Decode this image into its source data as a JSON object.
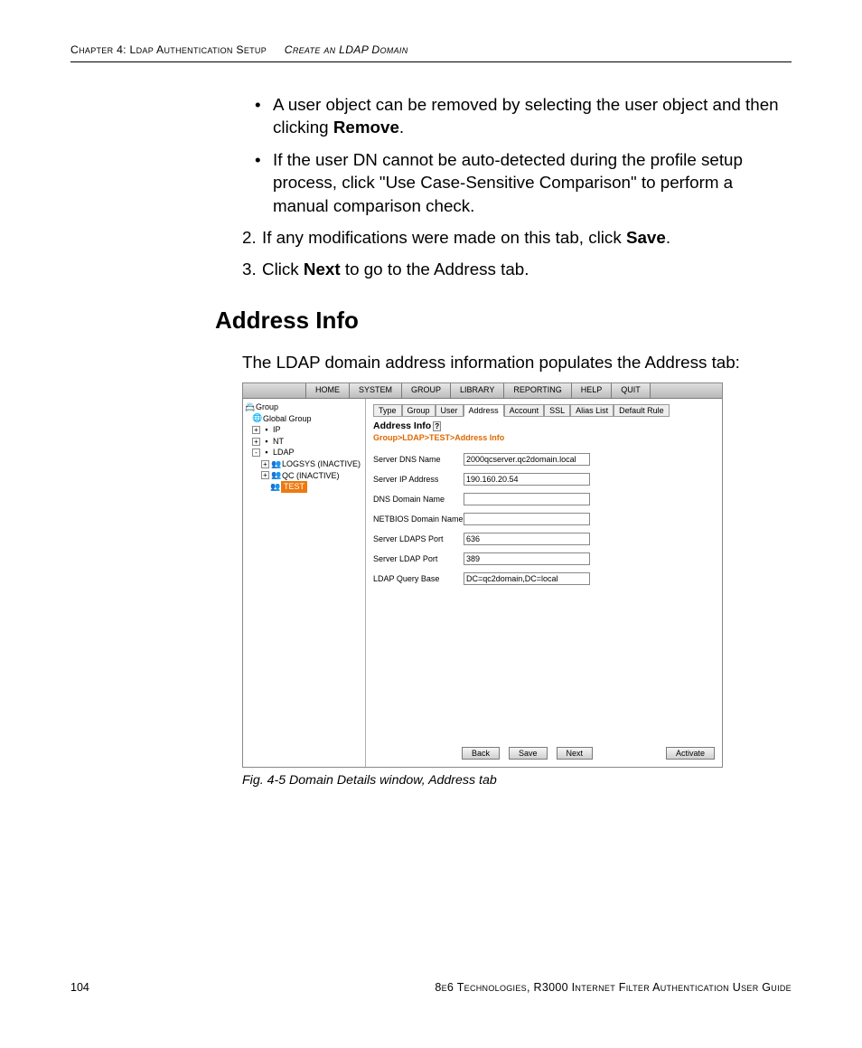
{
  "header": {
    "chapter": "Chapter 4: Ldap Authentication Setup",
    "section": "Create an LDAP Domain"
  },
  "body": {
    "bullet1_a": "A user object can be removed by selecting the user object and then clicking ",
    "bullet1_b_bold": "Remove",
    "bullet1_c": ".",
    "bullet2": "If the user DN cannot be auto-detected during the profile setup process, click \"Use Case-Sensitive Comparison\" to perform a manual comparison check.",
    "step2_num": "2.",
    "step2_a": "If any modifications were made on this tab, click ",
    "step2_b_bold": "Save",
    "step2_c": ".",
    "step3_num": "3.",
    "step3_a": "Click ",
    "step3_b_bold": "Next",
    "step3_c": " to go to the Address tab.",
    "heading": "Address Info",
    "intro": "The LDAP domain address information populates the Address tab:",
    "caption": "Fig. 4-5  Domain Details window, Address tab"
  },
  "footer": {
    "page": "104",
    "guide": "8e6 Technologies, R3000 Internet Filter Authentication User Guide"
  },
  "screenshot": {
    "menu": [
      "HOME",
      "SYSTEM",
      "GROUP",
      "LIBRARY",
      "REPORTING",
      "HELP",
      "QUIT"
    ],
    "tree": {
      "root": "Group",
      "n0": "Global Group",
      "n1": "IP",
      "n2": "NT",
      "n3": "LDAP",
      "n3a": "LOGSYS (INACTIVE)",
      "n3b": "QC (INACTIVE)",
      "n3c": "TEST"
    },
    "tabs": [
      "Type",
      "Group",
      "User",
      "Address",
      "Account",
      "SSL",
      "Alias List",
      "Default Rule"
    ],
    "active_tab_index": 3,
    "panel_title": "Address Info",
    "breadcrumb": "Group>LDAP>TEST>Address Info",
    "fields": {
      "server_dns_name": {
        "label": "Server DNS Name",
        "value": "2000qcserver.qc2domain.local"
      },
      "server_ip": {
        "label": "Server IP Address",
        "value": "190.160.20.54"
      },
      "dns_domain": {
        "label": "DNS Domain Name",
        "value": ""
      },
      "netbios": {
        "label": "NETBIOS Domain Name",
        "value": ""
      },
      "ldaps_port": {
        "label": "Server LDAPS Port",
        "value": "636"
      },
      "ldap_port": {
        "label": "Server LDAP Port",
        "value": "389"
      },
      "query_base": {
        "label": "LDAP Query Base",
        "value": "DC=qc2domain,DC=local"
      }
    },
    "buttons": {
      "back": "Back",
      "save": "Save",
      "next": "Next",
      "activate": "Activate"
    }
  }
}
